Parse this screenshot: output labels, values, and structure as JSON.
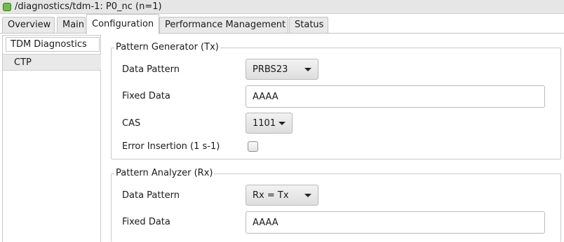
{
  "window": {
    "title": "/diagnostics/tdm-1: P0_nc (n=1)",
    "status_color": "#6cbe45"
  },
  "tabs": [
    {
      "label": "Overview",
      "active": false
    },
    {
      "label": "Main",
      "active": false
    },
    {
      "label": "Configuration",
      "active": true
    },
    {
      "label": "Performance Management",
      "active": false
    },
    {
      "label": "Status",
      "active": false
    }
  ],
  "subtabs": [
    {
      "label": "TDM Diagnostics",
      "active": true
    },
    {
      "label": "CTP",
      "active": false
    }
  ],
  "tx": {
    "title": "Pattern Generator (Tx)",
    "data_pattern_label": "Data Pattern",
    "data_pattern_value": "PRBS23",
    "fixed_data_label": "Fixed Data",
    "fixed_data_value": "AAAA",
    "cas_label": "CAS",
    "cas_value": "1101",
    "error_insertion_label": "Error Insertion (1 s-1)",
    "error_insertion_checked": false
  },
  "rx": {
    "title": "Pattern Analyzer (Rx)",
    "data_pattern_label": "Data Pattern",
    "data_pattern_value": "Rx = Tx",
    "fixed_data_label": "Fixed Data",
    "fixed_data_value": "AAAA"
  }
}
